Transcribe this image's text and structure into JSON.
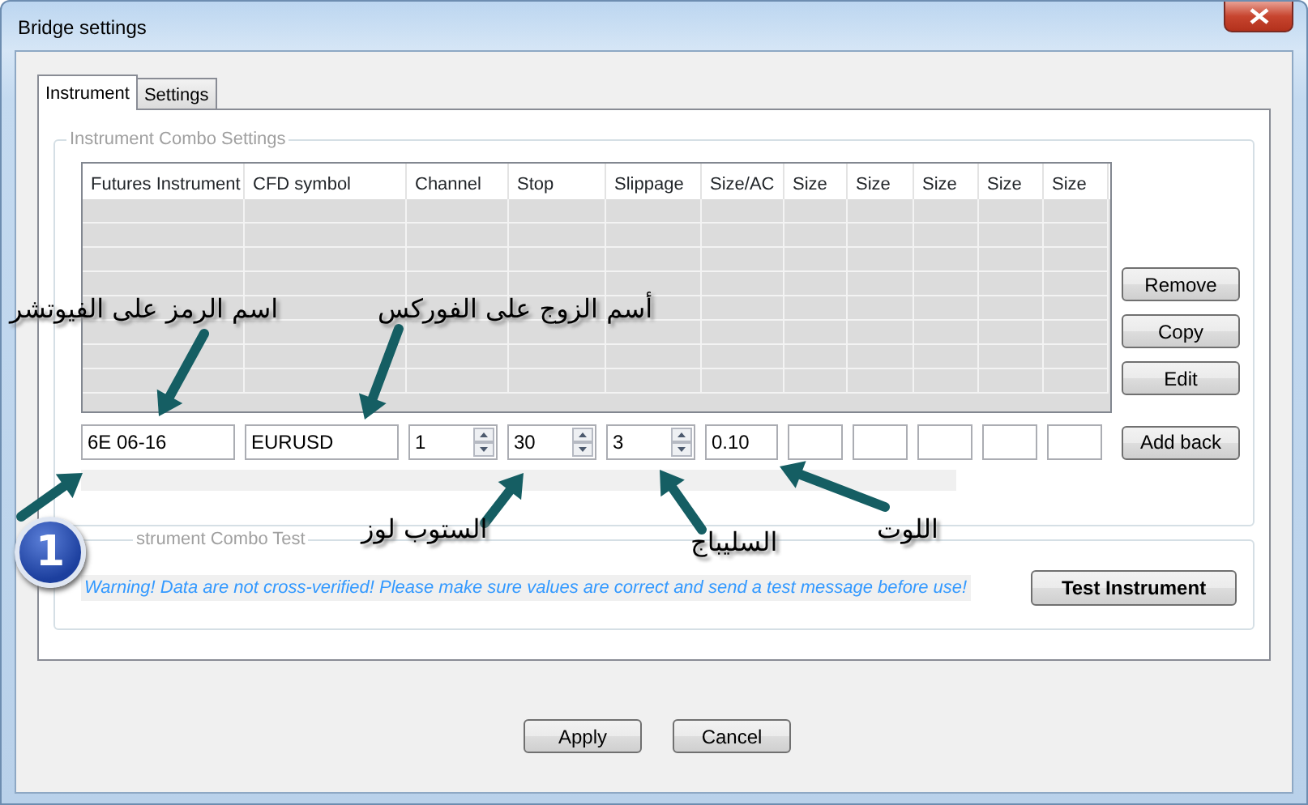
{
  "window": {
    "title": "Bridge settings"
  },
  "tabs": [
    {
      "label": "Instrument",
      "selected": true
    },
    {
      "label": "Settings",
      "selected": false
    }
  ],
  "combo_settings": {
    "legend": "Instrument Combo Settings",
    "columns": [
      "Futures Instrument",
      "CFD symbol",
      "Channel",
      "Stop",
      "Slippage",
      "Size/AC",
      "Size",
      "Size",
      "Size",
      "Size",
      "Size"
    ],
    "inputs": [
      {
        "kind": "text",
        "value": "6E 06-16"
      },
      {
        "kind": "text",
        "value": "EURUSD"
      },
      {
        "kind": "spin",
        "value": "1"
      },
      {
        "kind": "spin",
        "value": "30"
      },
      {
        "kind": "spin",
        "value": "3"
      },
      {
        "kind": "text",
        "value": "0.10"
      },
      {
        "kind": "text"
      },
      {
        "kind": "text"
      },
      {
        "kind": "text"
      },
      {
        "kind": "text"
      },
      {
        "kind": "text"
      }
    ],
    "side_buttons": [
      "Remove",
      "Copy",
      "Edit"
    ],
    "add_button": "Add back"
  },
  "combo_test": {
    "legend": "strument Combo Test",
    "warning": "Warning!  Data are not cross-verified!  Please make sure values are correct and send a test message before use!",
    "button": "Test Instrument"
  },
  "footer_buttons": [
    "Apply",
    "Cancel"
  ],
  "annotations": {
    "badge": "1",
    "labels": [
      {
        "text": "أسم الزوج على الفوركس"
      },
      {
        "text": "اسم الرمز على الفيوتشر"
      },
      {
        "text": "الستوب لوز"
      },
      {
        "text": "السليباج"
      },
      {
        "text": "اللوت"
      }
    ]
  }
}
